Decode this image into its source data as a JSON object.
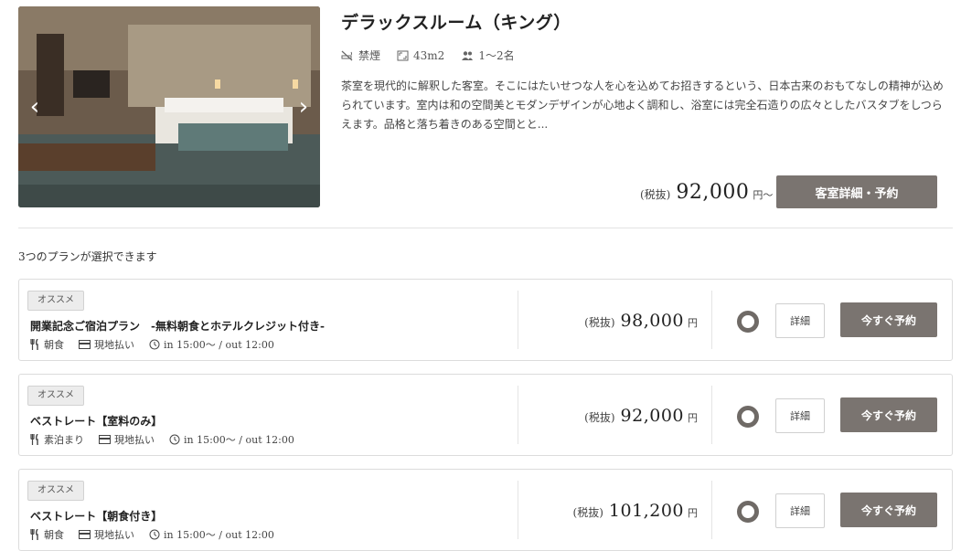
{
  "room": {
    "name": "デラックスルーム（キング）",
    "smoking": "禁煙",
    "size": "43m2",
    "capacity": "1〜2名",
    "description": "茶室を現代的に解釈した客室。そこにはたいせつな人を心を込めてお招きするという、日本古来のおもてなしの精神が込められています。室内は和の空間美とモダンデザインが心地よく調和し、浴室には完全石造りの広々としたバスタブをしつらえます。品格と落ち着きのある空間とと...",
    "tax_label": "(税抜)",
    "price": "92,000",
    "price_suffix": "円〜",
    "detail_button": "客室詳細・予約",
    "icons": {
      "prev": "chevron-left-icon",
      "next": "chevron-right-icon"
    }
  },
  "plans_count_text": "3つのプランが選択できます",
  "plans": [
    {
      "badge": "オススメ",
      "name": "開業記念ご宿泊プラン　-無料朝食とホテルクレジット付き-",
      "meal": "朝食",
      "payment": "現地払い",
      "time": "in 15:00〜 / out 12:00",
      "tax_label": "(税抜)",
      "price": "98,000",
      "yen": "円",
      "detail_label": "詳細",
      "book_label": "今すぐ予約"
    },
    {
      "badge": "オススメ",
      "name": "ベストレート【室料のみ】",
      "meal": "素泊まり",
      "payment": "現地払い",
      "time": "in 15:00〜 / out 12:00",
      "tax_label": "(税抜)",
      "price": "92,000",
      "yen": "円",
      "detail_label": "詳細",
      "book_label": "今すぐ予約"
    },
    {
      "badge": "オススメ",
      "name": "ベストレート【朝食付き】",
      "meal": "朝食",
      "payment": "現地払い",
      "time": "in 15:00〜 / out 12:00",
      "tax_label": "(税抜)",
      "price": "101,200",
      "yen": "円",
      "detail_label": "詳細",
      "book_label": "今すぐ予約"
    }
  ],
  "colors": {
    "button": "#7a7470",
    "radio": "#6f6a66",
    "border": "#dcdcdc"
  }
}
